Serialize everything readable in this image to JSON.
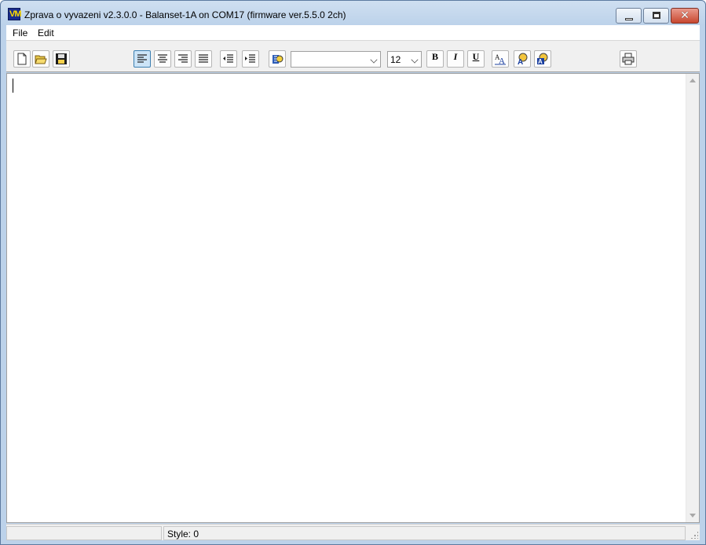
{
  "window": {
    "title": "Zprava o vyvazeni v2.3.0.0 - Balanset-1A on COM17 (firmware ver.5.5.0 2ch)",
    "icon_text": "VM"
  },
  "menu": {
    "items": [
      {
        "label": "File"
      },
      {
        "label": "Edit"
      }
    ]
  },
  "toolbar": {
    "font_name": "",
    "font_size": "12",
    "bold_label": "B",
    "italic_label": "I",
    "underline_label": "U",
    "active_alignment": "align-left"
  },
  "icons": {
    "file": [
      "new-document-icon",
      "open-folder-icon",
      "save-disk-icon"
    ],
    "align": [
      "align-left-icon",
      "align-center-icon",
      "align-right-icon",
      "align-justify-icon"
    ],
    "indent": [
      "decrease-indent-icon",
      "increase-indent-icon"
    ],
    "other": [
      "paragraph-format-icon",
      "font-icon",
      "text-color-icon",
      "background-color-icon",
      "print-icon"
    ]
  },
  "status": {
    "panel1": "",
    "panel2": "Style: 0"
  }
}
